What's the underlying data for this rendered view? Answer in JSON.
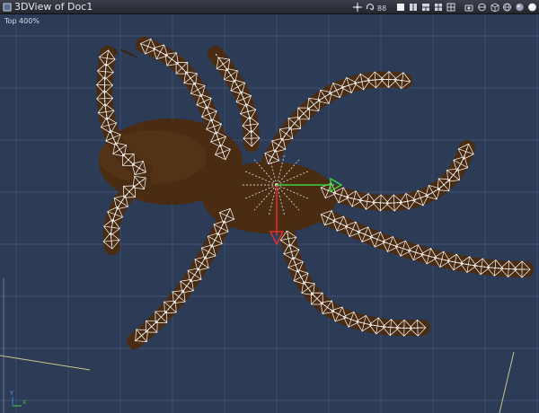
{
  "window": {
    "title": "3DView of Doc1",
    "icon": "window-3d-icon"
  },
  "toolbar": {
    "buttons": [
      {
        "name": "move-tool-button",
        "icon": "move-icon"
      },
      {
        "name": "rotate-tool-button",
        "icon": "rotate-icon"
      },
      {
        "name": "walk-tool-button",
        "icon": "walk-icon"
      },
      {
        "name": "single-view-button",
        "icon": "layout-single-icon"
      },
      {
        "name": "two-view-button",
        "icon": "layout-two-icon"
      },
      {
        "name": "three-view-button",
        "icon": "layout-three-icon"
      },
      {
        "name": "four-view-button",
        "icon": "layout-four-icon"
      },
      {
        "name": "grid-view-button",
        "icon": "layout-grid-icon"
      },
      {
        "name": "camera-button",
        "icon": "camera-icon"
      },
      {
        "name": "display-mode-button",
        "icon": "display-mode-icon"
      },
      {
        "name": "bounding-box-button",
        "icon": "box-icon"
      },
      {
        "name": "wireframe-button",
        "icon": "wireframe-sphere-icon"
      },
      {
        "name": "shaded-button",
        "icon": "shaded-sphere-icon"
      },
      {
        "name": "render-button",
        "icon": "render-sphere-icon"
      }
    ]
  },
  "viewport": {
    "label": "Top 400%",
    "background_color": "#2c3b56",
    "grid_color": "#46587a",
    "mesh_color": "#4a2c12",
    "wire_color": "#ffffff",
    "axes": {
      "x_color": "#3cd23c",
      "y_color": "#e03030"
    }
  },
  "corner_axes": {
    "x": "X",
    "y": "Y"
  }
}
